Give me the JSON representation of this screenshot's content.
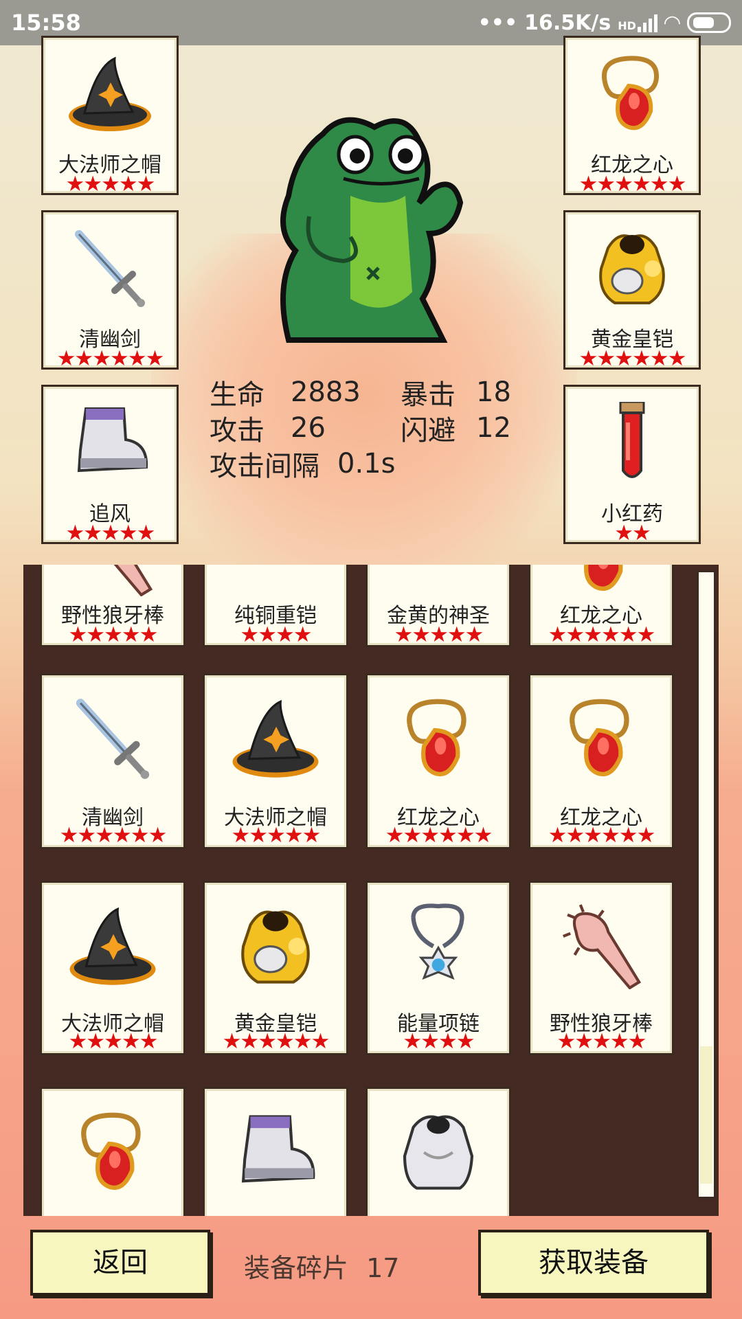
{
  "status_bar": {
    "time": "15:58",
    "network": "16.5K/s",
    "net_type": "HD"
  },
  "stats": {
    "hp_label": "生命",
    "hp": "2883",
    "crit_label": "暴击",
    "crit": "18",
    "atk_label": "攻击",
    "atk": "26",
    "dodge_label": "闪避",
    "dodge": "12",
    "interval_label": "攻击间隔",
    "interval": "0.1s"
  },
  "equipped": {
    "left": [
      {
        "name": "大法师之帽",
        "stars": "★★★★★",
        "icon": "wizard-hat-icon"
      },
      {
        "name": "清幽剑",
        "stars": "★★★★★★",
        "icon": "sword-icon"
      },
      {
        "name": "追风",
        "stars": "★★★★★",
        "icon": "boot-icon"
      }
    ],
    "right": [
      {
        "name": "红龙之心",
        "stars": "★★★★★★",
        "icon": "amulet-icon"
      },
      {
        "name": "黄金皇铠",
        "stars": "★★★★★★",
        "icon": "gold-armor-icon"
      },
      {
        "name": "小红药",
        "stars": "★★",
        "icon": "red-potion-icon"
      }
    ]
  },
  "inventory": {
    "rows": [
      [
        {
          "name": "野性狼牙棒",
          "stars": "★★★★★",
          "icon": "spiked-club-icon"
        },
        {
          "name": "纯铜重铠",
          "stars": "★★★★",
          "icon": "copper-armor-icon"
        },
        {
          "name": "金黄的神圣",
          "stars": "★★★★★",
          "icon": "holy-item-icon"
        },
        {
          "name": "红龙之心",
          "stars": "★★★★★★",
          "icon": "amulet-icon"
        }
      ],
      [
        {
          "name": "清幽剑",
          "stars": "★★★★★★",
          "icon": "sword-icon"
        },
        {
          "name": "大法师之帽",
          "stars": "★★★★★",
          "icon": "wizard-hat-icon"
        },
        {
          "name": "红龙之心",
          "stars": "★★★★★★",
          "icon": "amulet-icon"
        },
        {
          "name": "红龙之心",
          "stars": "★★★★★★",
          "icon": "amulet-icon"
        }
      ],
      [
        {
          "name": "大法师之帽",
          "stars": "★★★★★",
          "icon": "wizard-hat-icon"
        },
        {
          "name": "黄金皇铠",
          "stars": "★★★★★★",
          "icon": "gold-armor-icon"
        },
        {
          "name": "能量项链",
          "stars": "★★★★",
          "icon": "energy-necklace-icon"
        },
        {
          "name": "野性狼牙棒",
          "stars": "★★★★★",
          "icon": "spiked-club-icon"
        }
      ],
      [
        {
          "name": "",
          "stars": "",
          "icon": "amulet-icon"
        },
        {
          "name": "",
          "stars": "",
          "icon": "boot-icon"
        },
        {
          "name": "",
          "stars": "",
          "icon": "silver-armor-icon"
        }
      ]
    ]
  },
  "bottom": {
    "back_label": "返回",
    "shards_label": "装备碎片",
    "shards_count": "17",
    "get_equipment_label": "获取装备"
  },
  "colors": {
    "star": "#e01010",
    "panel": "#442a22",
    "button": "#f7f6bf",
    "card": "#fffdf0"
  }
}
